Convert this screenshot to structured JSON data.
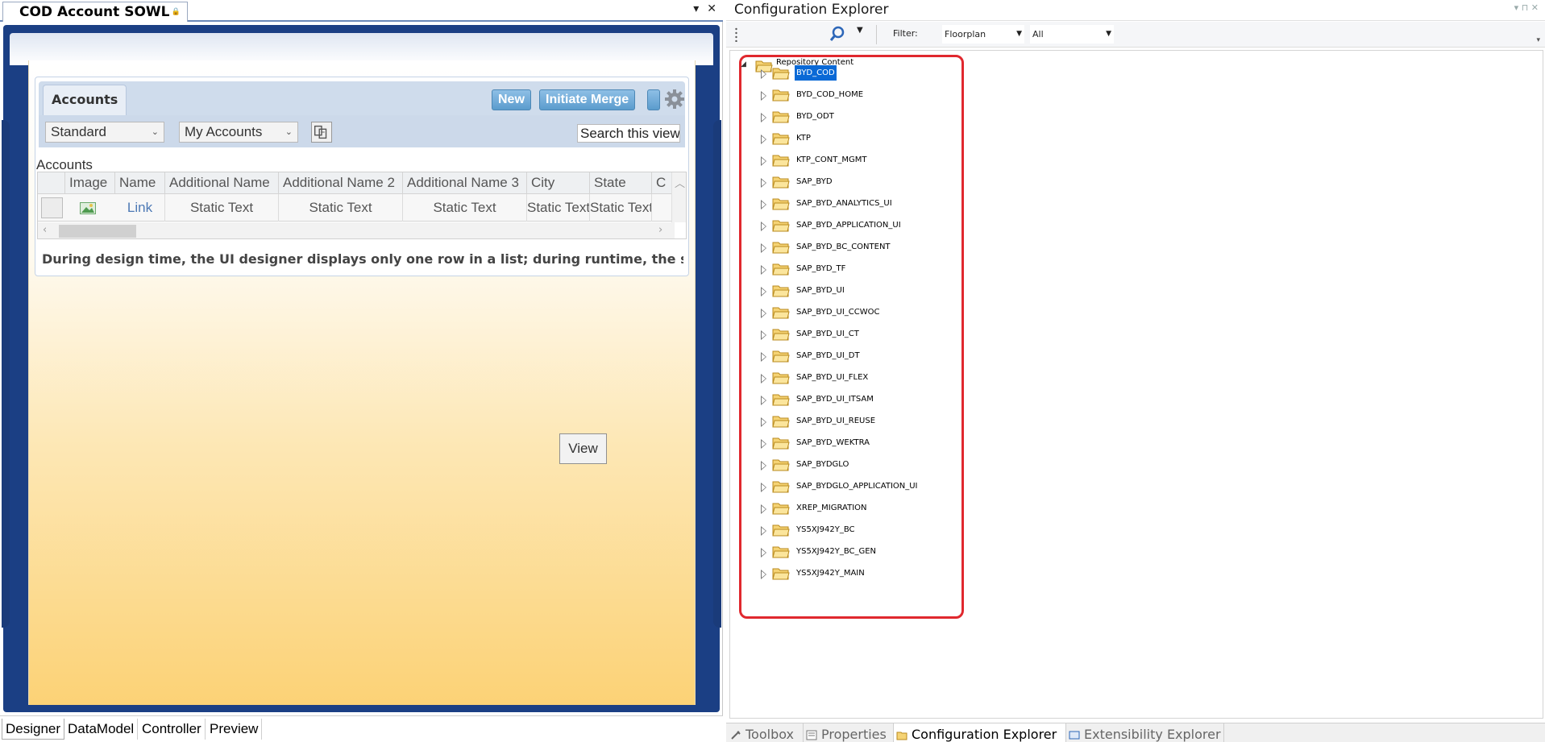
{
  "designer": {
    "tab_title": "COD Account SOWL",
    "tab_ctrls": [
      "▾",
      "✕"
    ],
    "accounts_tab": "Accounts",
    "buttons": {
      "new": "New",
      "initiate_merge": "Initiate Merge"
    },
    "filter1": "Standard",
    "filter2": "My Accounts",
    "search_placeholder": "Search this view",
    "list_caption": "Accounts",
    "columns": [
      "Image",
      "Name",
      "Additional Name",
      "Additional Name 2",
      "Additional Name 3",
      "City",
      "State",
      "C"
    ],
    "row": {
      "name": "Link",
      "additional_name": "Static Text",
      "additional_name_2": "Static Text",
      "additional_name_3": "Static Text",
      "city": "Static Text",
      "state": "Static Text"
    },
    "note": "During design time, the UI designer displays only one row in a list; during runtime, the system displa",
    "view_button": "View",
    "bottom_tabs": [
      "Designer",
      "DataModel",
      "Controller",
      "Preview"
    ]
  },
  "config_explorer": {
    "title": "Configuration Explorer",
    "filter_label": "Filter:",
    "filter_type": "Floorplan",
    "filter_scope": "All",
    "root": "Repository Content",
    "selected": "BYD_COD",
    "nodes": [
      "BYD_COD",
      "BYD_COD_HOME",
      "BYD_ODT",
      "KTP",
      "KTP_CONT_MGMT",
      "SAP_BYD",
      "SAP_BYD_ANALYTICS_UI",
      "SAP_BYD_APPLICATION_UI",
      "SAP_BYD_BC_CONTENT",
      "SAP_BYD_TF",
      "SAP_BYD_UI",
      "SAP_BYD_UI_CCWOC",
      "SAP_BYD_UI_CT",
      "SAP_BYD_UI_DT",
      "SAP_BYD_UI_FLEX",
      "SAP_BYD_UI_ITSAM",
      "SAP_BYD_UI_REUSE",
      "SAP_BYD_WEKTRA",
      "SAP_BYDGLO",
      "SAP_BYDGLO_APPLICATION_UI",
      "XREP_MIGRATION",
      "YS5XJ942Y_BC",
      "YS5XJ942Y_BC_GEN",
      "YS5XJ942Y_MAIN"
    ],
    "bottom_tabs": [
      "Toolbox",
      "Properties",
      "Configuration Explorer",
      "Extensibility Explorer"
    ],
    "active_tab": "Configuration Explorer"
  },
  "colors": {
    "highlight": "#e0282e",
    "selection": "#0a69d6",
    "frame": "#1b3f84",
    "button": "#5b9ccd"
  },
  "icons": [
    "lock-icon",
    "gear-icon",
    "filter-icon",
    "image-icon",
    "search-icon",
    "folder-icon",
    "expand-triangle-icon",
    "toolbox-icon",
    "properties-icon",
    "config-explorer-icon",
    "extensibility-icon"
  ]
}
